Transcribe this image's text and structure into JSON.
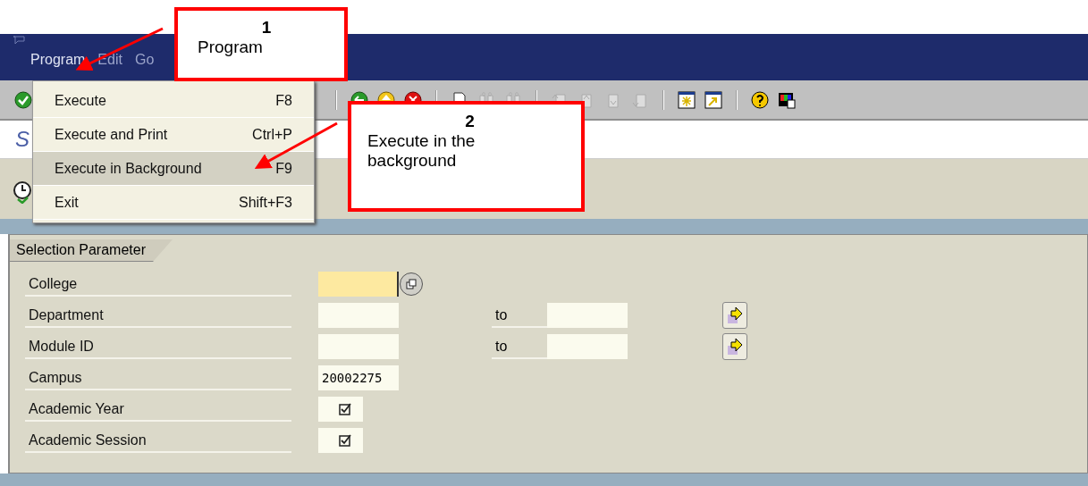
{
  "menu_bar": {
    "items": [
      {
        "label": "Program"
      },
      {
        "label": "Edit"
      },
      {
        "label": "Go"
      }
    ]
  },
  "program_menu": {
    "items": [
      {
        "label": "Execute",
        "shortcut": "F8",
        "selected": false
      },
      {
        "label": "Execute and Print",
        "shortcut": "Ctrl+P",
        "selected": false
      },
      {
        "label": "Execute in Background",
        "shortcut": "F9",
        "selected": true
      },
      {
        "label": "Exit",
        "shortcut": "Shift+F3",
        "selected": false
      }
    ]
  },
  "screen_title": "S",
  "selection_parameter": {
    "tab": "Selection Parameter",
    "rows": [
      {
        "kind": "lookup",
        "label": "College"
      },
      {
        "kind": "range",
        "label": "Department",
        "to_label": "to"
      },
      {
        "kind": "range",
        "label": "Module ID",
        "to_label": "to"
      },
      {
        "kind": "value",
        "label": "Campus",
        "value": "20002275"
      },
      {
        "kind": "checkbox",
        "label": "Academic Year",
        "checked": true
      },
      {
        "kind": "checkbox",
        "label": "Academic Session",
        "checked": true
      }
    ]
  },
  "callouts": [
    {
      "number": "1",
      "text": "Program"
    },
    {
      "number": "2",
      "text": "Execute in the background"
    }
  ]
}
